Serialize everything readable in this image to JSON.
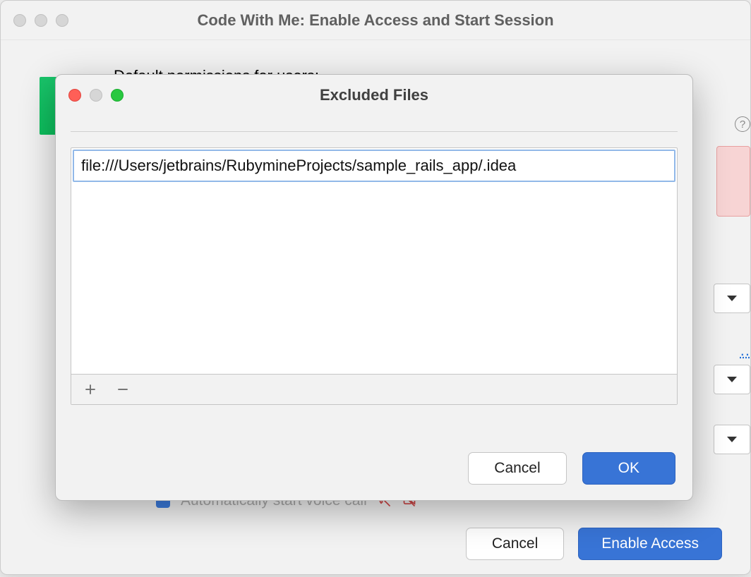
{
  "parent": {
    "title": "Code With Me: Enable Access and Start Session",
    "partial_label": "Default permissions for users:",
    "hidden_row_partial": "Automatically start voice call",
    "buttons": {
      "cancel": "Cancel",
      "enable": "Enable Access"
    }
  },
  "modal": {
    "title": "Excluded Files",
    "list": {
      "items": [
        "file:///Users/jetbrains/RubymineProjects/sample_rails_app/.idea"
      ]
    },
    "buttons": {
      "cancel": "Cancel",
      "ok": "OK"
    }
  }
}
